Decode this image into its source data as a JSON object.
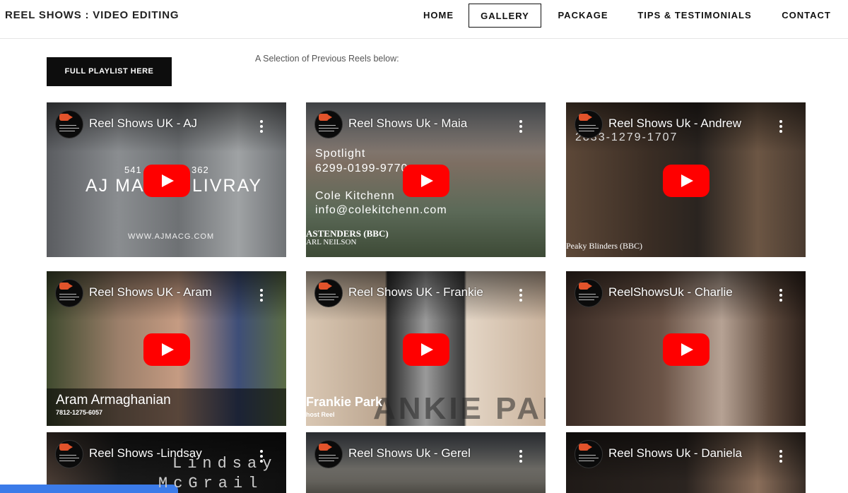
{
  "header": {
    "brand": "REEL SHOWS : VIDEO EDITING",
    "nav": [
      {
        "label": "HOME",
        "active": false
      },
      {
        "label": "GALLERY",
        "active": true
      },
      {
        "label": "PACKAGE",
        "active": false
      },
      {
        "label": "TIPS & TESTIMONIALS",
        "active": false
      },
      {
        "label": "CONTACT",
        "active": false
      }
    ]
  },
  "cta": {
    "label": "FULL PLAYLIST HERE"
  },
  "intro": "A Selection of Previous Reels below:",
  "videos": [
    {
      "title": "Reel Shows UK - AJ",
      "overlays": [
        "541",
        "362",
        "AJ MA",
        "LIVRAY",
        "WWW.AJMACG.COM"
      ]
    },
    {
      "title": "Reel Shows Uk - Maia",
      "overlays": [
        "Spotlight",
        "6299-0199-9770",
        "Cole Kitchenn",
        "info@colekitchenn.com",
        "ASTENDERS (BBC)",
        "ARL NEILSON"
      ]
    },
    {
      "title": "Reel Shows Uk - Andrew",
      "overlays": [
        "2833-1279-1707",
        "Peaky Blinders (BBC)"
      ]
    },
    {
      "title": "Reel Shows UK - Aram",
      "overlays": [
        "Aram Armaghanian",
        "7812-1275-6057"
      ]
    },
    {
      "title": "Reel Shows UK - Frankie",
      "overlays": [
        "Frankie Park",
        "host Reel",
        "ANKIE PARK"
      ]
    },
    {
      "title": "ReelShowsUk - Charlie",
      "overlays": []
    },
    {
      "title": "Reel Shows -Lindsay",
      "overlays": [
        "Lindsay",
        "McGrail"
      ]
    },
    {
      "title": "Reel Shows Uk - Gerel",
      "overlays": []
    },
    {
      "title": "Reel Shows Uk - Daniela",
      "overlays": []
    }
  ],
  "colors": {
    "accent": "#0d0d0d",
    "play": "#ff0000",
    "channel_logo": "#e2532b",
    "bottom_bar": "#3b7be9"
  },
  "icons": {
    "play": "play-icon",
    "menu": "kebab-menu-icon",
    "channel": "channel-logo-icon"
  }
}
